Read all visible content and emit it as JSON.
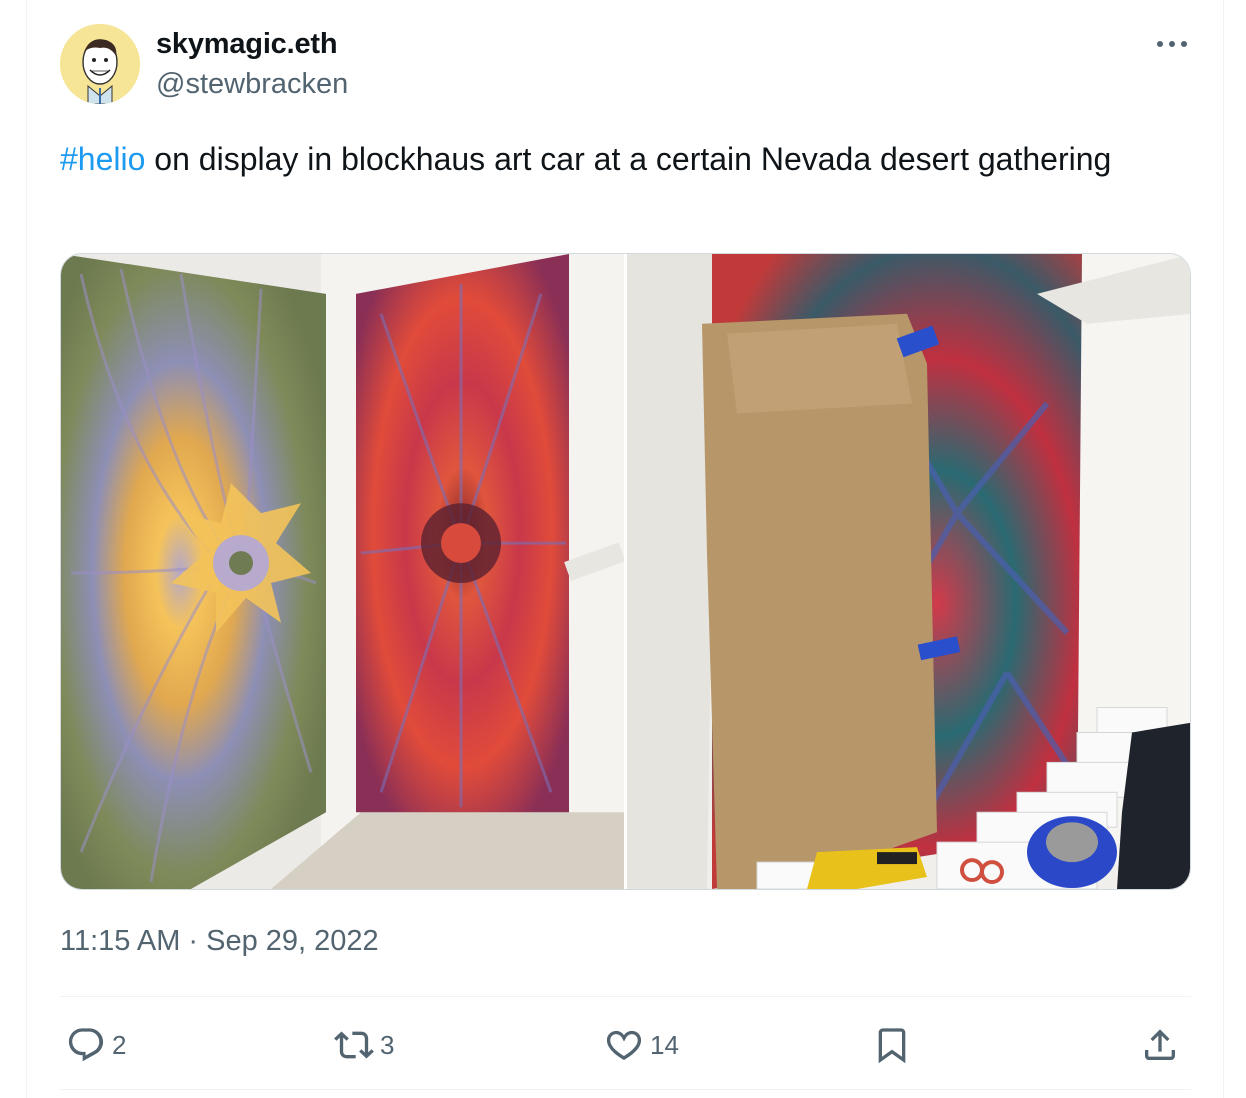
{
  "author": {
    "display_name": "skymagic.eth",
    "handle": "@stewbracken",
    "avatar_icon": "cartoon-face-avatar"
  },
  "tweet": {
    "hashtag": "#helio",
    "text": " on display in blockhaus art car at a certain Nevada desert gathering",
    "timestamp": "11:15 AM · Sep 29, 2022"
  },
  "media": {
    "photos": [
      {
        "icon": "kaleidoscope-panels-photo"
      },
      {
        "icon": "covered-wall-mural-photo"
      }
    ]
  },
  "actions": {
    "reply_count": "2",
    "retweet_count": "3",
    "like_count": "14"
  },
  "colors": {
    "accent": "#1d9bf0",
    "secondary_text": "#536471",
    "border": "#cfd9de"
  }
}
